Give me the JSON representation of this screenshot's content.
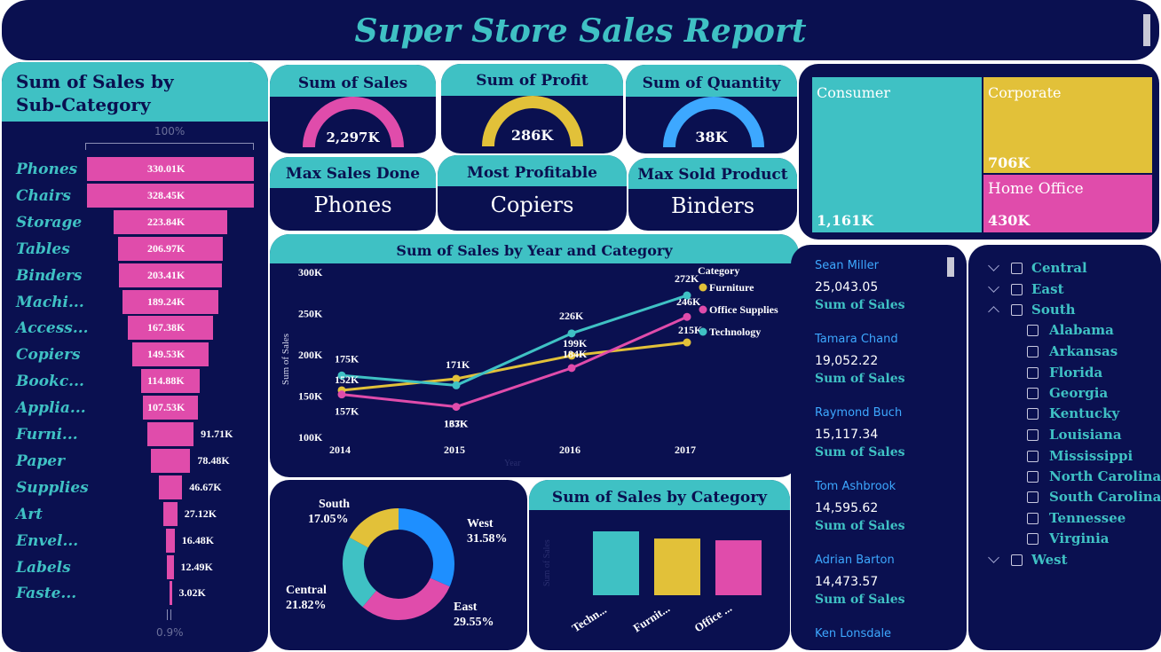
{
  "title": "Super Store Sales Report",
  "subcategory": {
    "title": "Sum of Sales by Sub-Category",
    "title_line1": "Sum of Sales by",
    "title_line2": "Sub-Category",
    "top_pct": "100%",
    "bottom_pct": "0.9%",
    "items": [
      {
        "label": "Phones",
        "value": 330.01,
        "value_label": "330.01K"
      },
      {
        "label": "Chairs",
        "value": 328.45,
        "value_label": "328.45K"
      },
      {
        "label": "Storage",
        "value": 223.84,
        "value_label": "223.84K"
      },
      {
        "label": "Tables",
        "value": 206.97,
        "value_label": "206.97K"
      },
      {
        "label": "Binders",
        "value": 203.41,
        "value_label": "203.41K"
      },
      {
        "label": "Machi...",
        "value": 189.24,
        "value_label": "189.24K"
      },
      {
        "label": "Access...",
        "value": 167.38,
        "value_label": "167.38K"
      },
      {
        "label": "Copiers",
        "value": 149.53,
        "value_label": "149.53K"
      },
      {
        "label": "Bookc...",
        "value": 114.88,
        "value_label": "114.88K"
      },
      {
        "label": "Applia...",
        "value": 107.53,
        "value_label": "107.53K"
      },
      {
        "label": "Furni...",
        "value": 91.71,
        "value_label": "91.71K"
      },
      {
        "label": "Paper",
        "value": 78.48,
        "value_label": "78.48K"
      },
      {
        "label": "Supplies",
        "value": 46.67,
        "value_label": "46.67K"
      },
      {
        "label": "Art",
        "value": 27.12,
        "value_label": "27.12K"
      },
      {
        "label": "Envel...",
        "value": 16.48,
        "value_label": "16.48K"
      },
      {
        "label": "Labels",
        "value": 12.49,
        "value_label": "12.49K"
      },
      {
        "label": "Faste...",
        "value": 3.02,
        "value_label": "3.02K"
      }
    ]
  },
  "kpis": {
    "sales": {
      "title": "Sum of Sales",
      "value": "2,297K",
      "fill": 0.5,
      "color": "#e04cab"
    },
    "profit": {
      "title": "Sum of Profit",
      "value": "286K",
      "fill": 0.5,
      "color": "#e2c139"
    },
    "quantity": {
      "title": "Sum of Quantity",
      "value": "38K",
      "fill": 0.5,
      "color": "#3da8ff"
    }
  },
  "cards": {
    "max_sales": {
      "title": "Max Sales Done",
      "value": "Phones"
    },
    "most_profitable": {
      "title": "Most Profitable",
      "value": "Copiers"
    },
    "max_sold": {
      "title": "Max Sold Product",
      "value": "Binders"
    }
  },
  "treemap": {
    "consumer": {
      "label": "Consumer",
      "value": "1,161K",
      "color": "#3fc1c4"
    },
    "corporate": {
      "label": "Corporate",
      "value": "706K",
      "color": "#e2c139"
    },
    "home_office": {
      "label": "Home Office",
      "value": "430K",
      "color": "#e04cab"
    }
  },
  "top_customers": [
    {
      "name": "Sean Miller",
      "value": "25,043.05",
      "measure": "Sum of Sales"
    },
    {
      "name": "Tamara Chand",
      "value": "19,052.22",
      "measure": "Sum of Sales"
    },
    {
      "name": "Raymond Buch",
      "value": "15,117.34",
      "measure": "Sum of Sales"
    },
    {
      "name": "Tom Ashbrook",
      "value": "14,595.62",
      "measure": "Sum of Sales"
    },
    {
      "name": "Adrian Barton",
      "value": "14,473.57",
      "measure": "Sum of Sales"
    },
    {
      "name": "Ken Lonsdale",
      "value": "",
      "measure": ""
    }
  ],
  "region_slicer": {
    "regions": [
      {
        "label": "Central",
        "expanded": false
      },
      {
        "label": "East",
        "expanded": false
      },
      {
        "label": "South",
        "expanded": true
      },
      {
        "label": "West",
        "expanded": false
      }
    ],
    "south_states": [
      "Alabama",
      "Arkansas",
      "Florida",
      "Georgia",
      "Kentucky",
      "Louisiana",
      "Mississippi",
      "North Carolina",
      "South Carolina",
      "Tennessee",
      "Virginia"
    ]
  },
  "chart_data": [
    {
      "type": "bar",
      "title": "Sum of Sales by Sub-Category",
      "orientation": "horizontal",
      "categories": [
        "Phones",
        "Chairs",
        "Storage",
        "Tables",
        "Binders",
        "Machi...",
        "Access...",
        "Copiers",
        "Bookc...",
        "Applia...",
        "Furni...",
        "Paper",
        "Supplies",
        "Art",
        "Envel...",
        "Labels",
        "Faste..."
      ],
      "values": [
        330.01,
        328.45,
        223.84,
        206.97,
        203.41,
        189.24,
        167.38,
        149.53,
        114.88,
        107.53,
        91.71,
        78.48,
        46.67,
        27.12,
        16.48,
        12.49,
        3.02
      ],
      "unit": "K"
    },
    {
      "type": "line",
      "title": "Sum of Sales by Year and Category",
      "xlabel": "Year",
      "ylabel": "Sum of Sales",
      "x": [
        "2014",
        "2015",
        "2016",
        "2017"
      ],
      "ylim": [
        100,
        300
      ],
      "yticks": [
        "100K",
        "150K",
        "200K",
        "250K",
        "300K"
      ],
      "legend_title": "Category",
      "legend_position": "right",
      "series": [
        {
          "name": "Furniture",
          "color": "#e2c139",
          "values": [
            157,
            171,
            199,
            215
          ],
          "labels": [
            "",
            "171K",
            "199K",
            "215K"
          ]
        },
        {
          "name": "Office Supplies",
          "color": "#e04cab",
          "values": [
            152,
            137,
            184,
            246
          ],
          "labels": [
            "157K",
            "137K",
            "184K",
            "246K"
          ]
        },
        {
          "name": "Technology",
          "color": "#3fc1c4",
          "values": [
            175,
            163,
            226,
            272
          ],
          "labels": [
            "175K",
            "163K",
            "226K",
            "272K"
          ]
        }
      ],
      "extra_labels": [
        "152K"
      ]
    },
    {
      "type": "pie",
      "title": "",
      "slices": [
        {
          "name": "West",
          "value": 31.58,
          "label": "31.58%",
          "color": "#1e8fff"
        },
        {
          "name": "East",
          "value": 29.55,
          "label": "29.55%",
          "color": "#e04cab"
        },
        {
          "name": "Central",
          "value": 21.82,
          "label": "21.82%",
          "color": "#3fc1c4"
        },
        {
          "name": "South",
          "value": 17.05,
          "label": "17.05%",
          "color": "#e2c139"
        }
      ]
    },
    {
      "type": "bar",
      "title": "Sum of Sales by Category",
      "ylabel": "Sum of Sales",
      "categories": [
        "Techn...",
        "Furnit...",
        "Office ..."
      ],
      "values": [
        836,
        742,
        719
      ],
      "colors": [
        "#3fc1c4",
        "#e2c139",
        "#e04cab"
      ]
    }
  ]
}
